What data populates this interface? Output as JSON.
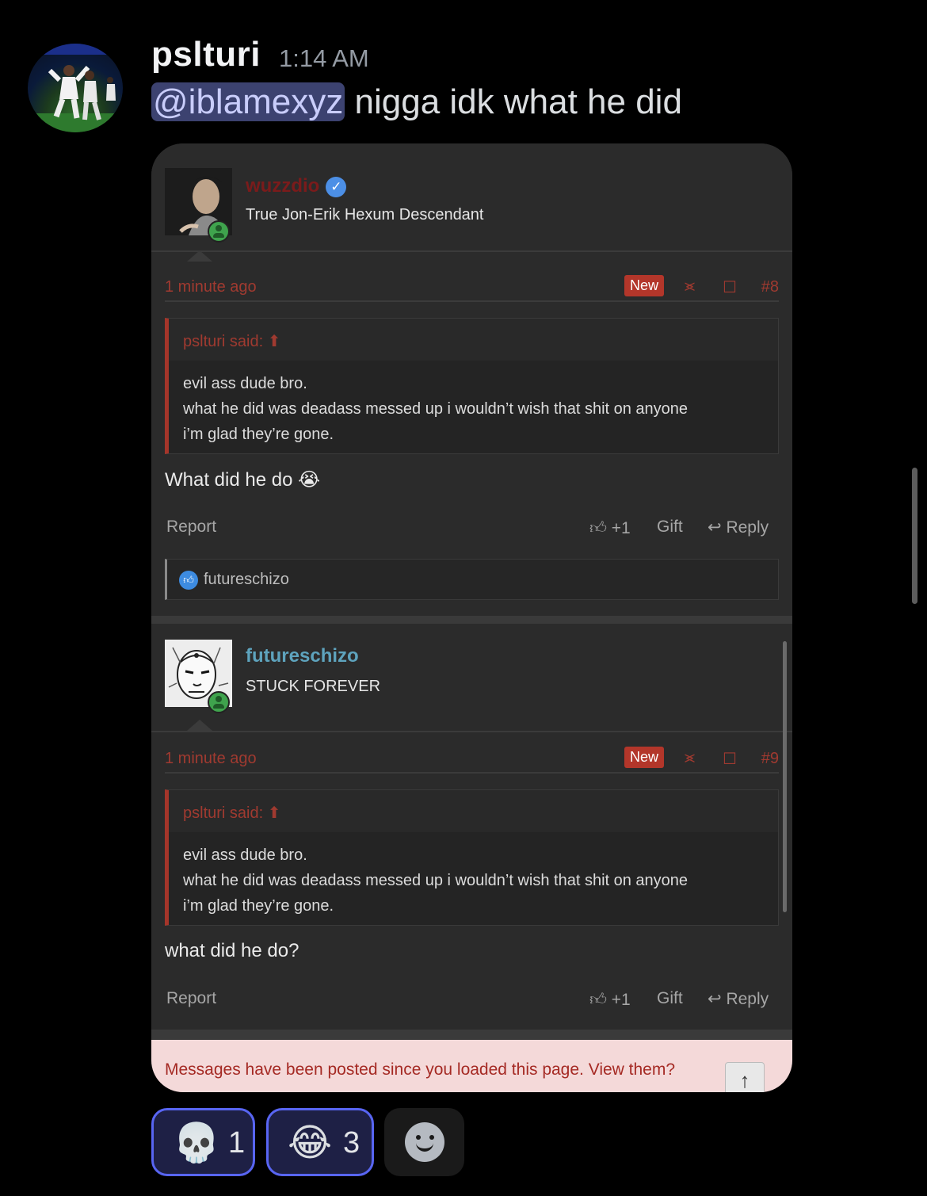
{
  "message": {
    "author": "pslturi",
    "timestamp": "1:14 AM",
    "mention": "@iblamexyz",
    "text": " nigga idk what he did"
  },
  "embed": {
    "posts": [
      {
        "author": "wuzzdio",
        "author_color": "#8b1a1a",
        "verified": true,
        "user_title": "True Jon-Erik Hexum Descendant",
        "time_ago": "1 minute ago",
        "badge": "New",
        "post_number": "#8",
        "quote_attribution": "pslturi said:",
        "quote_lines": [
          "evil ass dude bro.",
          "what he did was deadass messed up i wouldn’t wish that shit on anyone",
          "i’m glad they’re gone."
        ],
        "body": "What did he do 😭",
        "actions": {
          "report": "Report",
          "like": "+1",
          "gift": "Gift",
          "reply": "Reply"
        },
        "reactions": {
          "users": "futureschizo"
        }
      },
      {
        "author": "futureschizo",
        "author_color": "#5ea3bd",
        "verified": false,
        "user_title": "STUCK FOREVER",
        "time_ago": "1 minute ago",
        "badge": "New",
        "post_number": "#9",
        "quote_attribution": "pslturi said:",
        "quote_lines": [
          "evil ass dude bro.",
          "what he did was deadass messed up i wouldn’t wish that shit on anyone",
          "i’m glad they’re gone."
        ],
        "body": "what did he do?",
        "actions": {
          "report": "Report",
          "like": "+1",
          "gift": "Gift",
          "reply": "Reply"
        }
      }
    ],
    "banner": "Messages have been posted since you loaded this page. View them?",
    "scroll_top_icon": "arrow-up-icon"
  },
  "reactions": [
    {
      "emoji": "💀",
      "name": "skull",
      "count": "1"
    },
    {
      "emoji": "😂",
      "name": "joy",
      "count": "3"
    }
  ],
  "add_reaction_icon": "smiley-face-icon"
}
